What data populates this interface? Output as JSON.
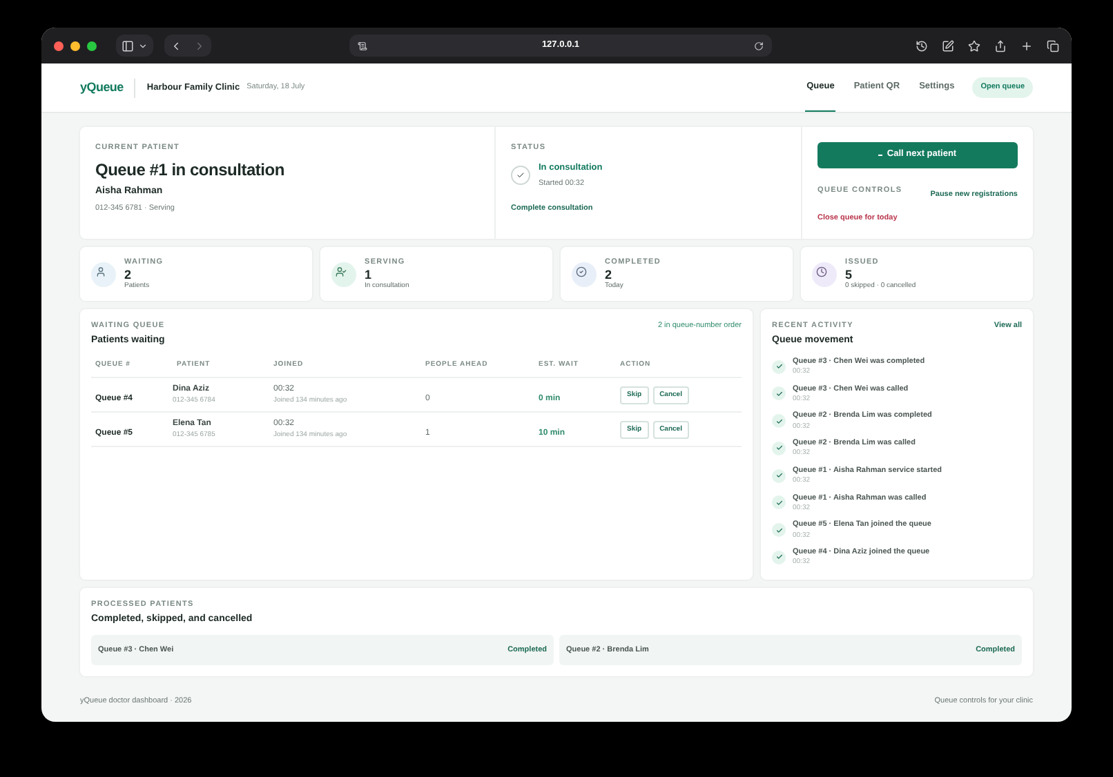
{
  "browser": {
    "url": "127.0.0.1"
  },
  "header": {
    "logo": "yQueue",
    "clinic": "Harbour Family Clinic",
    "date": "Saturday, 18 July",
    "nav": [
      {
        "label": "Queue",
        "selected": true
      },
      {
        "label": "Patient QR",
        "selected": false
      },
      {
        "label": "Settings",
        "selected": false
      }
    ],
    "open_queue": "Open queue"
  },
  "current_patient": {
    "label": "CURRENT PATIENT",
    "title": "Queue #1 in consultation",
    "name": "Aisha Rahman",
    "detail": "012-345 6781 · Serving"
  },
  "status": {
    "label": "STATUS",
    "state": "In consultation",
    "started": "Started 00:32",
    "action": "Complete consultation"
  },
  "controls": {
    "call_next": "Call next patient",
    "label": "QUEUE CONTROLS",
    "pause": "Pause new registrations",
    "close": "Close queue for today"
  },
  "stats": [
    {
      "kind": "person",
      "label": "WAITING",
      "value": "2",
      "sub": "Patients",
      "color": "#e8f2f8"
    },
    {
      "kind": "serving",
      "label": "SERVING",
      "value": "1",
      "sub": "In consultation",
      "color": "#e3f4ec"
    },
    {
      "kind": "done",
      "label": "COMPLETED",
      "value": "2",
      "sub": "Today",
      "color": "#e8eff8"
    },
    {
      "kind": "clock",
      "label": "ISSUED",
      "value": "5",
      "sub": "0 skipped · 0 cancelled",
      "color": "#efeafa"
    }
  ],
  "waiting_queue": {
    "label": "WAITING QUEUE",
    "title": "Patients waiting",
    "order": "2 in queue-number order",
    "columns": [
      "QUEUE #",
      "PATIENT",
      "JOINED",
      "PEOPLE AHEAD",
      "EST. WAIT",
      "ACTION"
    ],
    "rows": [
      {
        "queue": "Queue #4",
        "name": "Dina Aziz",
        "phone": "012-345 6784",
        "time": "00:32",
        "joined": "Joined 134 minutes ago",
        "ahead": "0",
        "wait": "0 min",
        "skip": "Skip",
        "cancel": "Cancel"
      },
      {
        "queue": "Queue #5",
        "name": "Elena Tan",
        "phone": "012-345 6785",
        "time": "00:32",
        "joined": "Joined 134 minutes ago",
        "ahead": "1",
        "wait": "10 min",
        "skip": "Skip",
        "cancel": "Cancel"
      }
    ]
  },
  "activity": {
    "label": "RECENT ACTIVITY",
    "view_all": "View all",
    "title": "Queue movement",
    "items": [
      {
        "text": "Queue #3 · Chen Wei was completed",
        "time": "00:32"
      },
      {
        "text": "Queue #3 · Chen Wei was called",
        "time": "00:32"
      },
      {
        "text": "Queue #2 · Brenda Lim was completed",
        "time": "00:32"
      },
      {
        "text": "Queue #2 · Brenda Lim was called",
        "time": "00:32"
      },
      {
        "text": "Queue #1 · Aisha Rahman service started",
        "time": "00:32"
      },
      {
        "text": "Queue #1 · Aisha Rahman was called",
        "time": "00:32"
      },
      {
        "text": "Queue #5 · Elena Tan joined the queue",
        "time": "00:32"
      },
      {
        "text": "Queue #4 · Dina Aziz joined the queue",
        "time": "00:32"
      }
    ]
  },
  "processed": {
    "label": "PROCESSED PATIENTS",
    "title": "Completed, skipped, and cancelled",
    "items": [
      {
        "name": "Queue #3 · Chen Wei",
        "status": "Completed"
      },
      {
        "name": "Queue #2 · Brenda Lim",
        "status": "Completed"
      }
    ]
  },
  "footer": {
    "left": "yQueue doctor dashboard · 2026",
    "right": "Queue controls for your clinic"
  }
}
